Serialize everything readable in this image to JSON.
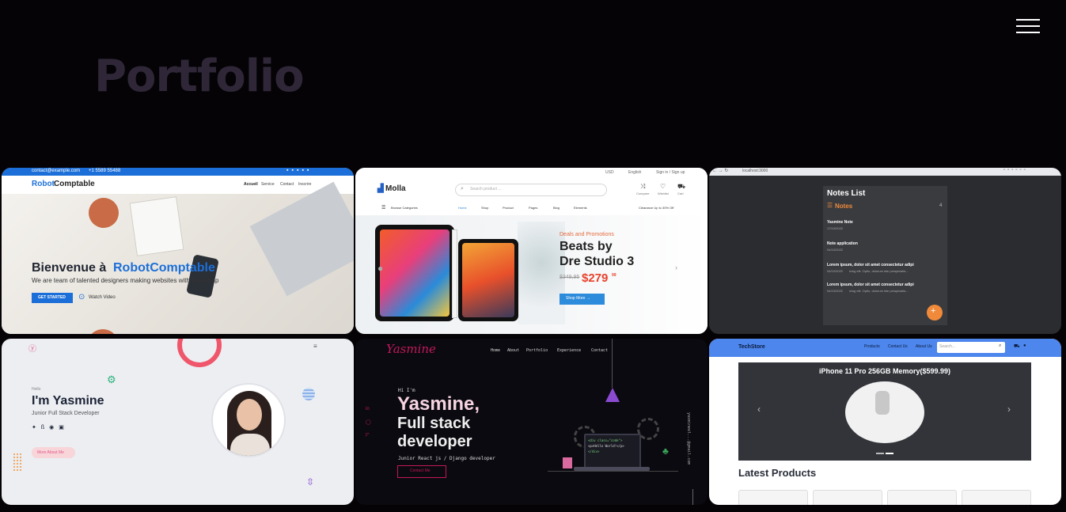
{
  "page": {
    "title": "Portfolio"
  },
  "colors": {
    "background": "#050306",
    "title": "#2f2738"
  },
  "menu": {
    "icon": "hamburger-menu-icon"
  },
  "cards": {
    "robotcomptable": {
      "topbar_email": "contact@example.com",
      "topbar_phone": "+1 5589 55488",
      "brand_part1": "Robot",
      "brand_part2": "Comptable",
      "nav": [
        "Accueil",
        "Service",
        "Contact",
        "Inscrire"
      ],
      "heading_part1": "Bienvenue à ",
      "heading_part2": "RobotComptable",
      "subtitle": "We are team of talented designers making websites with Bootstrap",
      "cta": "GET STARTED",
      "video": "Watch Video"
    },
    "molla": {
      "topbar_currency": "USD",
      "topbar_language": "English",
      "topbar_signin": "Sign in / Sign up",
      "logo": "Molla",
      "search_placeholder": "Search product ...",
      "icons": [
        "Compare",
        "Wishlist",
        "Cart"
      ],
      "browse": "Browse Categories",
      "nav": [
        "Home",
        "Shop",
        "Product",
        "Pages",
        "Blog",
        "Elements"
      ],
      "promo": "Clearance Up to 30% Off",
      "hero_tag": "Deals and Promotions",
      "hero_title_1": "Beats by",
      "hero_title_2": "Dre Studio 3",
      "old_price": "$349,95",
      "price": "$279",
      "price_cents": "99",
      "shop_btn": "Shop More →"
    },
    "notes": {
      "url": "localhost:3000",
      "title": "Notes List",
      "section": "Notes",
      "count": "4",
      "items": [
        {
          "title": "Yasmine Note",
          "date": "17/10/2022",
          "body": ""
        },
        {
          "title": "Note application",
          "date": "04/10/2022",
          "body": ""
        },
        {
          "title": "Lorem ipsum, dolor sit amet consectetur adipi",
          "date": "04/10/2022",
          "body": "icing elit. Optio, dolorum iste perspiciatis..."
        },
        {
          "title": "Lorem ipsum, dolor sit amet consectetur adipi",
          "date": "04/10/2022",
          "body": "icing elit. Optio, dolorum iste perspiciatis..."
        }
      ]
    },
    "yasmine_light": {
      "greeting": "Hello",
      "name": "I'm Yasmine",
      "role": "Junior Full Stack Developer",
      "btn": "More About Me"
    },
    "yasmine_dark": {
      "logo": "Yasmine",
      "nav": [
        "Home",
        "About",
        "Portfolio",
        "Experience",
        "Contact"
      ],
      "greeting": "Hi I'm",
      "line1": "Yasmine,",
      "line2": "Full stack",
      "line3": "developer",
      "subtitle": "Junior React js / Django developer",
      "btn": "Contact Me",
      "email_vertical": "yasmineel...@gmail.com",
      "code_lines": [
        "<div class=\"code\">",
        "<p>Hello World!</p>",
        "</div>"
      ]
    },
    "techstore": {
      "logo": "TechStore",
      "nav": [
        "Products",
        "Contact Us",
        "About Us"
      ],
      "search_placeholder": "Search...",
      "carousel_title": "iPhone 11 Pro 256GB Memory($599.99)",
      "latest": "Latest Products"
    }
  }
}
